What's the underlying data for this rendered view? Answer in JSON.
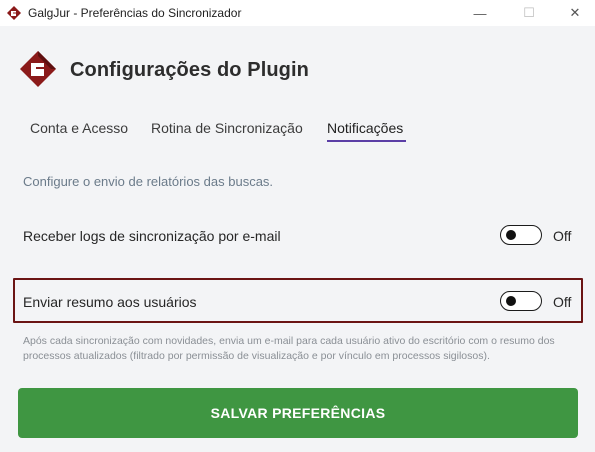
{
  "window": {
    "title": "GalgJur - Preferências do Sincronizador",
    "controls": {
      "minimize": "—",
      "maximize": "☐",
      "close": "✕"
    }
  },
  "header": {
    "title": "Configurações do Plugin",
    "logo_icon": "galgjur-logo-icon"
  },
  "tabs": [
    {
      "label": "Conta e Acesso",
      "active": false
    },
    {
      "label": "Rotina de Sincronização",
      "active": false
    },
    {
      "label": "Notificações",
      "active": true
    }
  ],
  "notifications": {
    "description": "Configure o envio de relatórios das buscas.",
    "settings": [
      {
        "label": "Receber logs de sincronização por e-mail",
        "enabled": false,
        "state_label": "Off"
      },
      {
        "label": "Enviar resumo aos usuários",
        "enabled": false,
        "state_label": "Off"
      }
    ],
    "help_text": "Após cada sincronização com novidades, envia um e-mail para cada usuário ativo do escritório com o resumo dos processos atualizados (filtrado por permissão de visualização e por vínculo em processos sigilosos)."
  },
  "footer": {
    "save_label": "SALVAR PREFERÊNCIAS"
  },
  "colors": {
    "accent": "#5b3ea6",
    "brand": "#8b1a1a",
    "highlight": "#6b1414",
    "save_button": "#3f9642"
  }
}
